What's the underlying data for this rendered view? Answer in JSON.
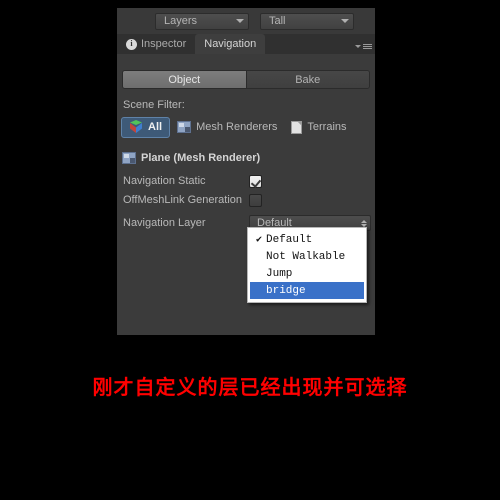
{
  "window": {
    "toolbar": {
      "layers_dropdown": "Layers",
      "tall_dropdown": "Tall",
      "dropdown_icon": "chevron-down-icon"
    },
    "tabs": [
      {
        "label": "Inspector",
        "icon": "info-circle-icon",
        "active": false
      },
      {
        "label": "Navigation",
        "active": true
      }
    ],
    "menu_icon": "hamburger-menu-icon"
  },
  "navigation": {
    "mode_tabs": [
      {
        "label": "Object",
        "active": true
      },
      {
        "label": "Bake",
        "active": false
      }
    ],
    "scene_filter": {
      "label": "Scene Filter:",
      "options": [
        {
          "label": "All",
          "icon": "cube-icon",
          "active": true
        },
        {
          "label": "Mesh Renderers",
          "icon": "mesh-renderer-icon",
          "active": false
        },
        {
          "label": "Terrains",
          "icon": "terrain-icon",
          "active": false
        }
      ]
    },
    "object": {
      "title": "Plane (Mesh Renderer)",
      "icon": "mesh-renderer-icon",
      "properties": [
        {
          "name": "Navigation Static",
          "type": "checkbox",
          "checked": true
        },
        {
          "name": "OffMeshLink Generation",
          "type": "checkbox",
          "checked": false
        },
        {
          "name": "Navigation Layer",
          "type": "popup",
          "value": "Default"
        }
      ]
    },
    "layer_dropdown": {
      "items": [
        {
          "label": "Default",
          "checked": true,
          "highlighted": false
        },
        {
          "label": "Not Walkable",
          "checked": false,
          "highlighted": false
        },
        {
          "label": "Jump",
          "checked": false,
          "highlighted": false
        },
        {
          "label": "bridge",
          "checked": false,
          "highlighted": true
        }
      ],
      "check_glyph": "✔",
      "highlight_color": "#3a71c8"
    }
  },
  "caption": {
    "text": "刚才自定义的层已经出现并可选择",
    "color": "#ff0000"
  }
}
